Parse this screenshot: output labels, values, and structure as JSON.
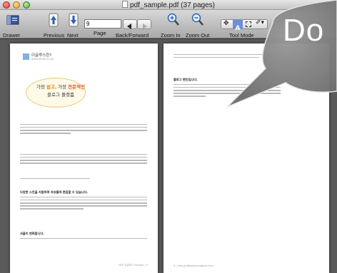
{
  "window": {
    "title": "pdf_sample.pdf (37 pages)"
  },
  "toolbar": {
    "drawer_label": "Drawer",
    "previous_label": "Previous",
    "next_label": "Next",
    "page_label": "Page",
    "page_value": "9",
    "back_forward_label": "Back/Forward",
    "zoom_in_label": "Zoom In",
    "zoom_out_label": "Zoom Out",
    "tool_mode_label": "Tool Mode",
    "tool_mode_text_glyph": "A"
  },
  "bubble": {
    "text": "Do"
  },
  "left_page": {
    "header_title": "이글루스란?",
    "header_sub": "2004.09.02 01:34",
    "headline_1a": "가장 ",
    "headline_1b": "쉽고",
    "headline_1c": ", 가장 ",
    "headline_1d": "전문적인",
    "headline_2": "블로그 플랫폼",
    "section_1": "다양한 스킨을 지원하며 자유롭게 편집할 수 있습니다.",
    "section_2": "서울이 변화합니다.",
    "footer": "PDF 이글루스 Sample | 3"
  },
  "right_page": {
    "section_title": "블로그 편안입니다.",
    "footer": "3 | http://pdfsample.egloos.com"
  },
  "colors": {
    "accent_orange": "#e48a1a",
    "accent_red": "#e0572a"
  }
}
